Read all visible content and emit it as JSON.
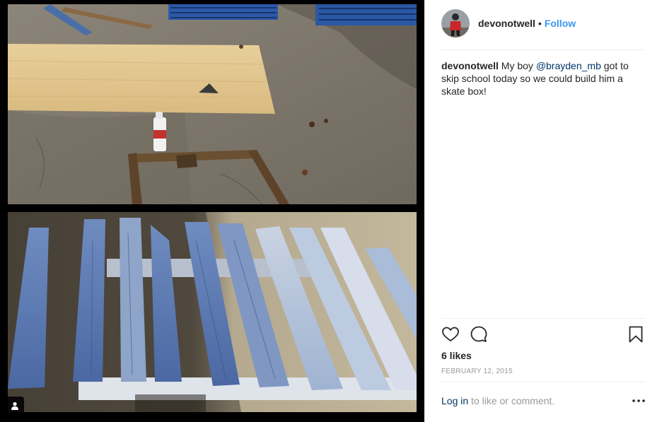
{
  "post": {
    "username": "devonotwell",
    "separator": "•",
    "follow_label": "Follow",
    "caption": {
      "username": "devonotwell",
      "text_before": "My boy",
      "mention": "@brayden_mb",
      "text_after": "got to skip school today so we could build him a skate box!"
    },
    "likes": "6 likes",
    "date": "FEBRUARY 12, 2015",
    "login_link": "Log in",
    "login_text": "to like or comment."
  },
  "icons": {
    "like": "heart-icon",
    "comment": "comment-icon",
    "save": "bookmark-icon",
    "more": "more-options-icon",
    "tag": "user-tag-icon"
  },
  "colors": {
    "link_blue": "#3897f0",
    "mention_navy": "#003569",
    "muted_gray": "#999999",
    "text_dark": "#262626"
  }
}
